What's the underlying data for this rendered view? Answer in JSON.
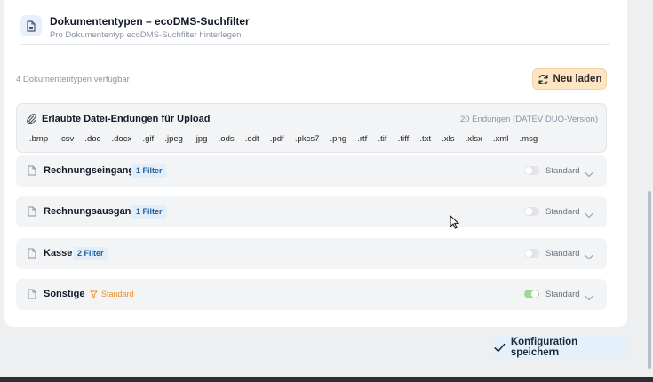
{
  "header": {
    "title": "Dokumententypen – ecoDMS-Suchfilter",
    "subtitle": "Pro Dokumententyp ecoDMS-Suchfilter hinterlegen",
    "icon": "document-icon"
  },
  "available_text": "4 Dokumententypen verfügbar",
  "reload_button": {
    "label": "Neu laden",
    "icon": "refresh-icon"
  },
  "extensions": {
    "title": "Erlaubte Datei-Endungen für Upload",
    "count_text": "20 Endungen (DATEV DUO-Version)",
    "icon": "paperclip-icon",
    "list": [
      ".bmp",
      ".csv",
      ".doc",
      ".docx",
      ".gif",
      ".jpeg",
      ".jpg",
      ".ods",
      ".odt",
      ".pdf",
      ".pkcs7",
      ".png",
      ".rtf",
      ".tif",
      ".tiff",
      ".txt",
      ".xls",
      ".xlsx",
      ".xml",
      ".msg"
    ]
  },
  "doc_types": [
    {
      "name": "Rechnungseingang",
      "badge": "1 Filter",
      "toggle_label": "Standard",
      "default_on": false
    },
    {
      "name": "Rechnungsausgang",
      "badge": "1 Filter",
      "toggle_label": "Standard",
      "default_on": false
    },
    {
      "name": "Kasse",
      "badge": "2 Filter",
      "toggle_label": "Standard",
      "default_on": false
    },
    {
      "name": "Sonstige",
      "badge": "Standard",
      "toggle_label": "Standard",
      "default_on": true
    }
  ],
  "save_button": {
    "label": "Konfiguration speichern",
    "icon": "check-icon"
  },
  "colors": {
    "accent_orange": "#f08b22",
    "reload_bg": "#fde4c3",
    "badge_bg": "#e3eefb",
    "toggle_on": "#9fd69a",
    "save_bg": "#e4f0fa"
  }
}
